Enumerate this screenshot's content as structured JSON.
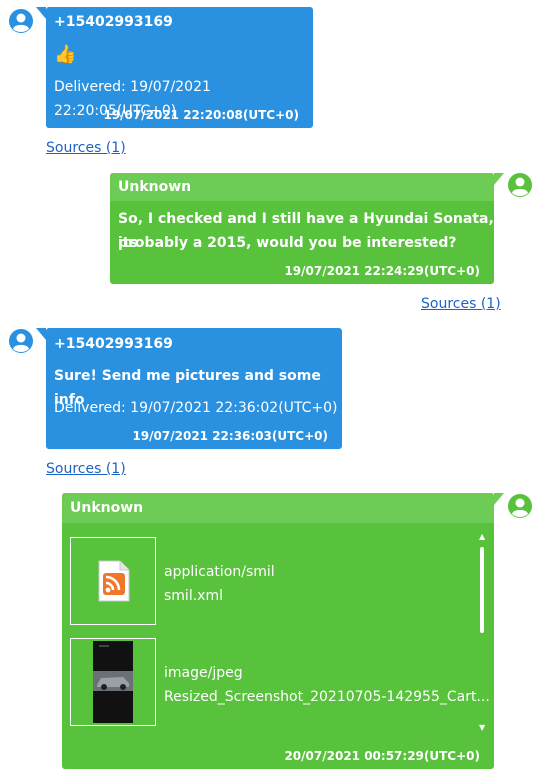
{
  "messages": [
    {
      "sender": "+15402993169",
      "body": "👍",
      "delivered": "Delivered: 19/07/2021 22:20:05(UTC+0)",
      "timestamp": "19/07/2021 22:20:08(UTC+0)",
      "sources": "Sources (1)"
    },
    {
      "sender": "Unknown",
      "body_lines": [
        "So, I checked and I still have a Hyundai Sonata, its",
        "probably a 2015, would you be interested?"
      ],
      "timestamp": "19/07/2021 22:24:29(UTC+0)",
      "sources": "Sources (1)"
    },
    {
      "sender": "+15402993169",
      "body": "Sure! Send me pictures and some info",
      "delivered": "Delivered: 19/07/2021 22:36:02(UTC+0)",
      "timestamp": "19/07/2021 22:36:03(UTC+0)",
      "sources": "Sources (1)"
    },
    {
      "sender": "Unknown",
      "attachments": [
        {
          "type": "application/smil",
          "name": "smil.xml",
          "icon": "rss-file-icon"
        },
        {
          "type": "image/jpeg",
          "name": "Resized_Screenshot_20210705-142955_Cart...",
          "icon": "screenshot-thumbnail"
        }
      ],
      "timestamp": "20/07/2021 00:57:29(UTC+0)"
    }
  ],
  "colors": {
    "incoming": "#2a91e0",
    "outgoing": "#58c23c",
    "outgoing_header": "#6dcc55",
    "link": "#1d62c5"
  }
}
